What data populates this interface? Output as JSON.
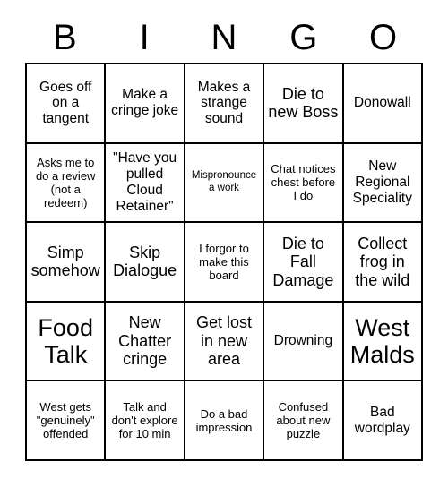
{
  "card": {
    "title_letters": [
      "B",
      "I",
      "N",
      "G",
      "O"
    ],
    "colors": {
      "border": "#000000",
      "cell_background": "#ffffff",
      "text": "#000000",
      "page_background": "#ffffff"
    },
    "grid": {
      "columns": 5,
      "rows": 5,
      "cells": [
        {
          "text": "Goes off on a tangent",
          "size": "md"
        },
        {
          "text": "Make a cringe joke",
          "size": "md"
        },
        {
          "text": "Makes a strange sound",
          "size": "md"
        },
        {
          "text": "Die to new Boss",
          "size": "lg"
        },
        {
          "text": "Donowall",
          "size": "md"
        },
        {
          "text": "Asks me to do a review (not a redeem)",
          "size": "sm"
        },
        {
          "text": "\"Have you pulled Cloud Retainer\"",
          "size": "md"
        },
        {
          "text": "Mispronounce a work",
          "size": "xs"
        },
        {
          "text": "Chat notices chest before I do",
          "size": "sm"
        },
        {
          "text": "New Regional Speciality",
          "size": "md"
        },
        {
          "text": "Simp somehow",
          "size": "lg"
        },
        {
          "text": "Skip Dialogue",
          "size": "lg"
        },
        {
          "text": "I forgor to make this board",
          "size": "sm"
        },
        {
          "text": "Die to Fall Damage",
          "size": "lg"
        },
        {
          "text": "Collect frog in the wild",
          "size": "lg"
        },
        {
          "text": "Food Talk",
          "size": "xl"
        },
        {
          "text": "New Chatter cringe",
          "size": "lg"
        },
        {
          "text": "Get lost in new area",
          "size": "lg"
        },
        {
          "text": "Drowning",
          "size": "md"
        },
        {
          "text": "West Malds",
          "size": "xl"
        },
        {
          "text": "West gets \"genuinely\" offended",
          "size": "sm"
        },
        {
          "text": "Talk and don't explore for 10 min",
          "size": "sm"
        },
        {
          "text": "Do a bad impression",
          "size": "sm"
        },
        {
          "text": "Confused about new puzzle",
          "size": "sm"
        },
        {
          "text": "Bad wordplay",
          "size": "md"
        }
      ]
    }
  }
}
